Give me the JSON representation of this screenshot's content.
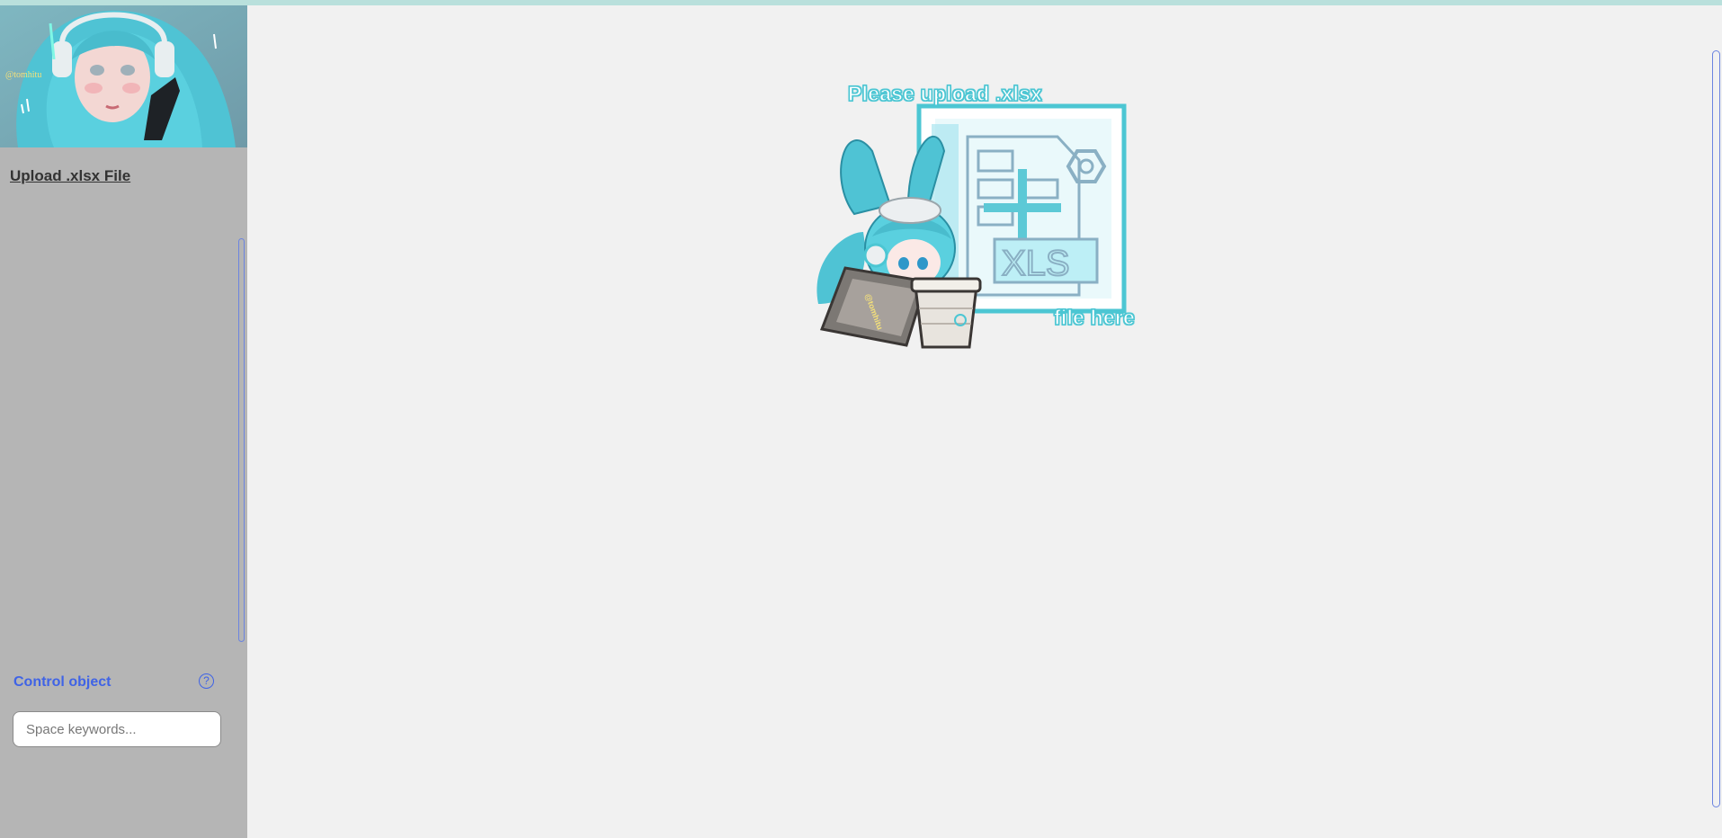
{
  "sidebar": {
    "banner_watermark": "@tomhitu",
    "upload_link": "Upload .xlsx File",
    "control_label": "Control object",
    "help_glyph": "?",
    "search_placeholder": "Space keywords..."
  },
  "main": {
    "dropzone_line1": "Please upload .xlsx",
    "dropzone_line2": "file here",
    "dropzone_file_label": "XLS",
    "dropzone_sign_watermark": "@tomhitu"
  },
  "colors": {
    "sidebar_bg": "#b5b5b5",
    "main_bg": "#f1f1f1",
    "accent": "#3f63e6",
    "teal": "#4cc6d3",
    "top_strip": "#b9e0dc"
  },
  "icons": [
    "help-icon",
    "upload-illustration",
    "banner-illustration"
  ]
}
